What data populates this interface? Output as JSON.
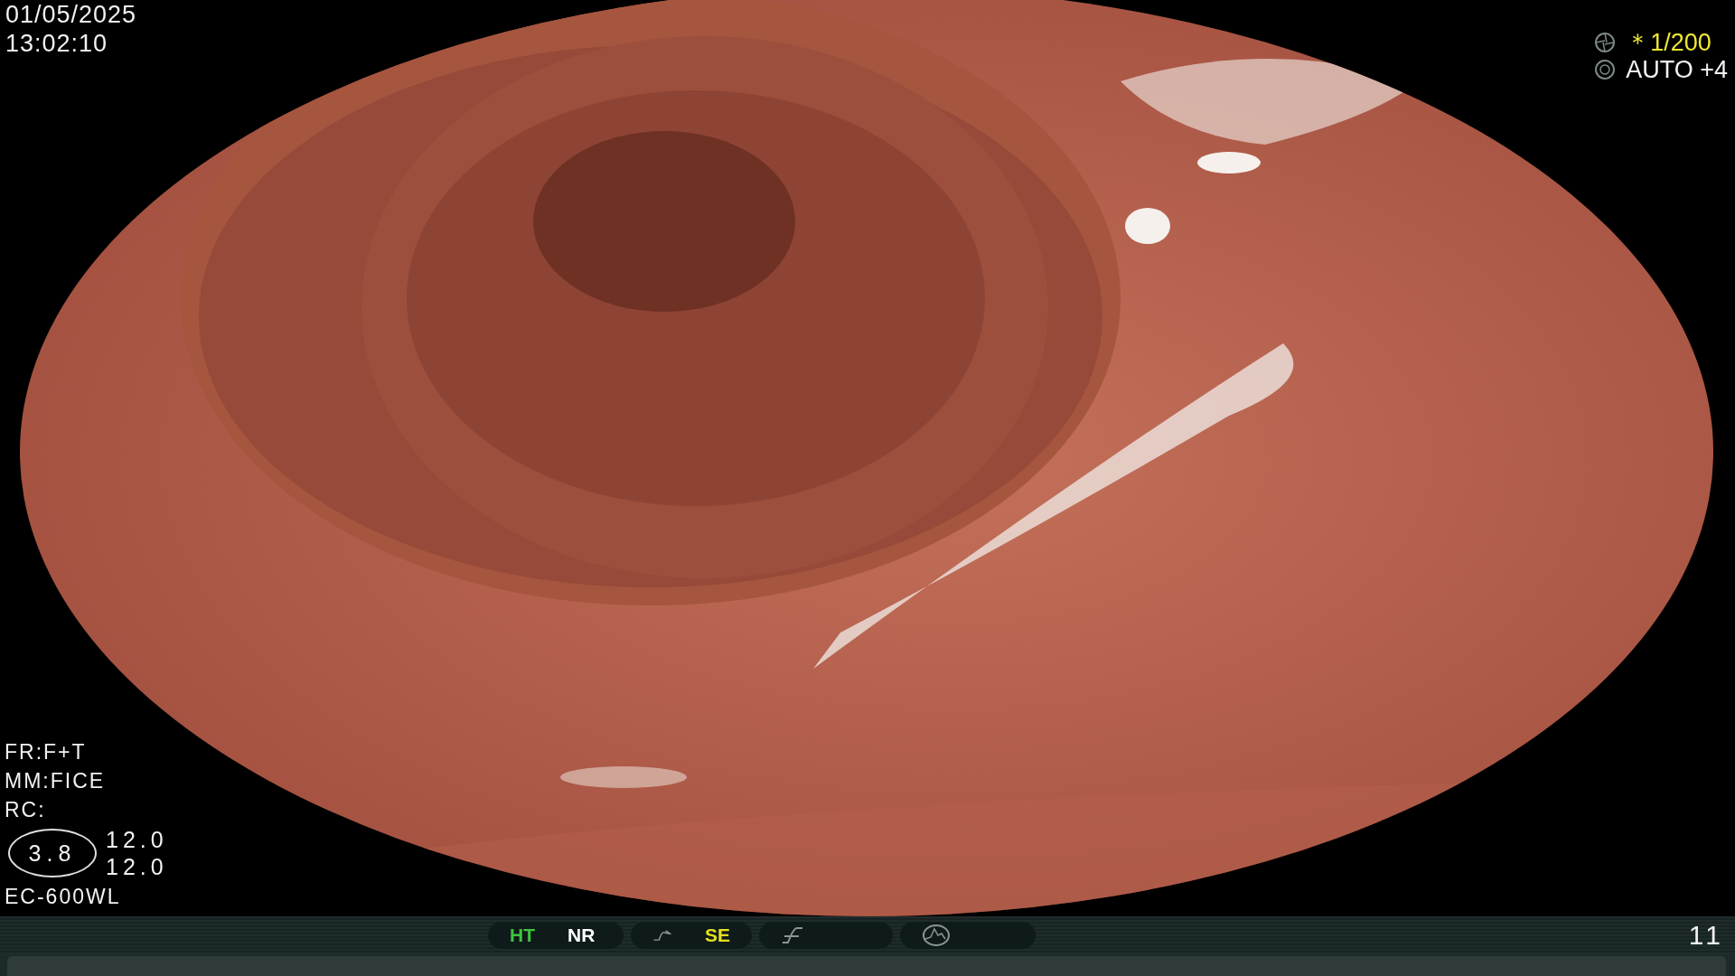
{
  "date": "01/05/2025",
  "time": "13:02:10",
  "exposure": {
    "shutter": "＊1/200",
    "iris": "AUTO +4"
  },
  "settings": [
    "FR:F+T",
    "MM:FICE",
    "RC:"
  ],
  "zoom_badge": "3.8",
  "readings": [
    "12.0",
    "12.0"
  ],
  "scope_model": "EC-600WL",
  "status_bar": {
    "groups": [
      {
        "items": [
          {
            "kind": "text",
            "label": "HT",
            "color": "#3ec43e"
          },
          {
            "kind": "text",
            "label": "NR",
            "color": "#ffffff"
          }
        ]
      },
      {
        "items": [
          {
            "kind": "curve-icon"
          },
          {
            "kind": "text",
            "label": "SE",
            "color": "#e6e01e"
          }
        ]
      },
      {
        "items": [
          {
            "kind": "slash-icon"
          }
        ]
      },
      {
        "items": [
          {
            "kind": "peak-icon"
          }
        ]
      }
    ],
    "counter": "11"
  }
}
